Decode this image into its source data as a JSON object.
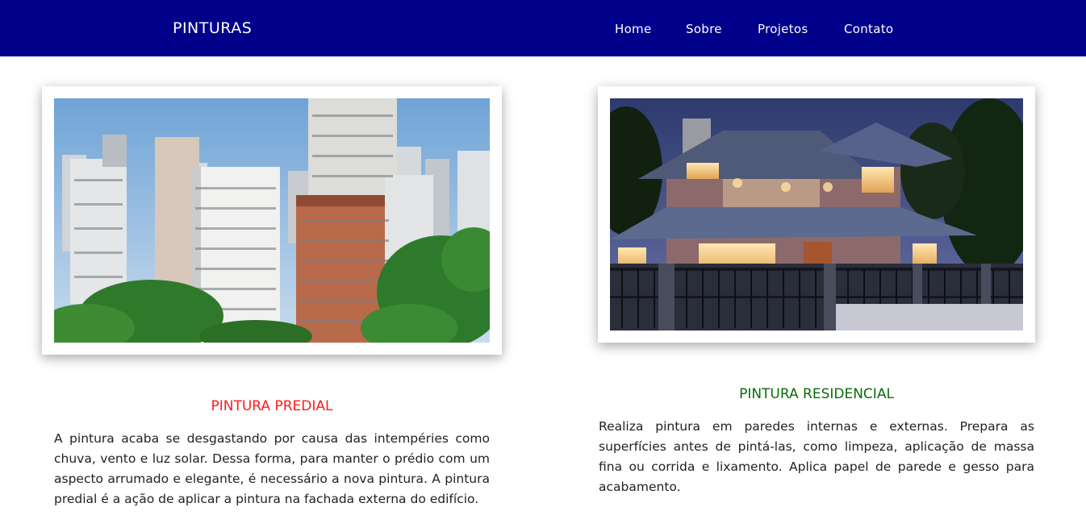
{
  "header": {
    "brand": "PINTURAS",
    "nav": {
      "home": "Home",
      "sobre": "Sobre",
      "projetos": "Projetos",
      "contato": "Contato"
    },
    "background_color": "#00008b"
  },
  "sections": {
    "predial": {
      "title": "PINTURA PREDIAL",
      "title_color": "#ff1a1a",
      "text": "A pintura acaba se desgastando por causa das intempéries como chuva, vento e luz solar. Dessa forma, para manter o prédio com um aspecto arrumado e elegante, é necessário a nova pintura. A pintura predial é a ação de aplicar a pintura na fachada externa do edifício."
    },
    "residencial": {
      "title": "PINTURA RESIDENCIAL",
      "title_color": "#0b6b0b",
      "text": "Realiza pintura em paredes internas e externas. Prepara as superfícies antes de pintá-las, como limpeza, aplicação de massa fina ou corrida e lixamento. Aplica papel de parede e gesso para acabamento."
    }
  }
}
